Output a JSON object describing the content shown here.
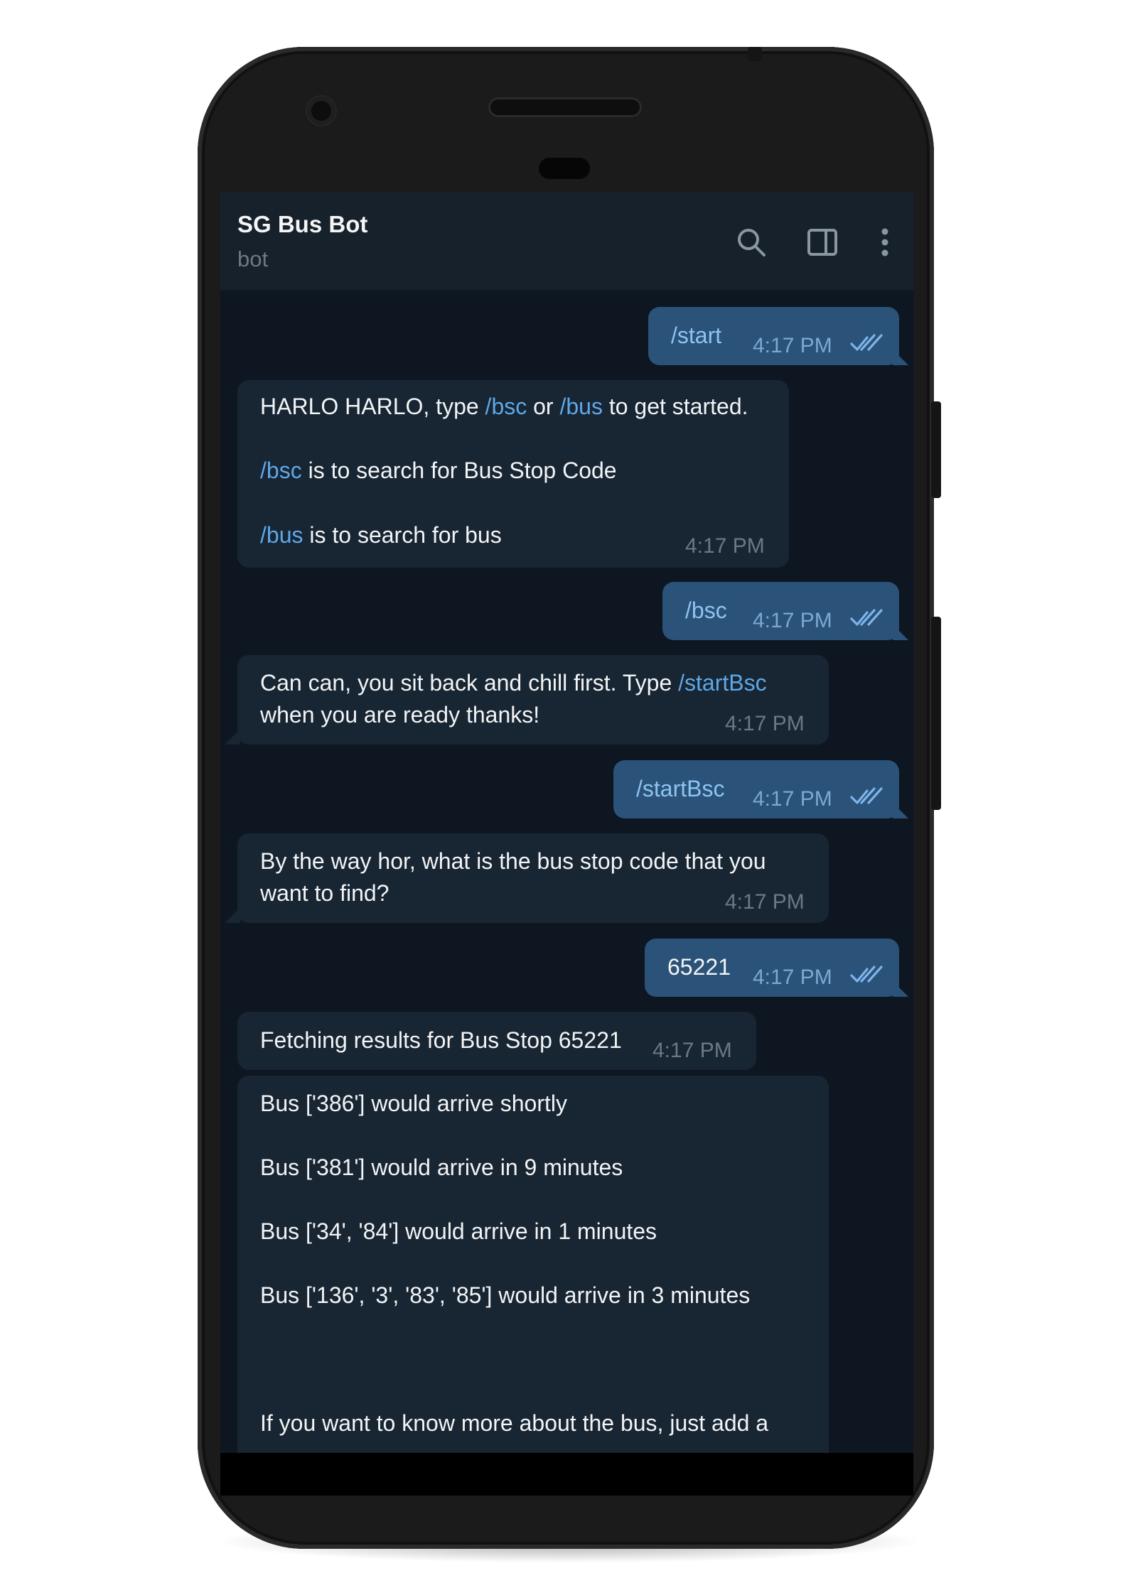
{
  "header": {
    "title": "SG Bus Bot",
    "status": "bot"
  },
  "icons": {
    "search": "search-icon",
    "side_panel": "side-panel-icon",
    "more": "more-vertical-icon",
    "read": "double-check-icon"
  },
  "colors": {
    "chat_bg": "#0e1621",
    "header_bg": "#17212b",
    "incoming_bubble": "#182533",
    "outgoing_bubble": "#2b5278",
    "command_link": "#5ea8e8",
    "timestamp": "#6d7883"
  },
  "messages": {
    "m1": {
      "text": "/start",
      "time": "4:17 PM"
    },
    "m2": {
      "l1a": "HARLO HARLO, type ",
      "l1b": "/bsc",
      "l1c": " or ",
      "l1d": "/bus",
      "l1e": " to get started.",
      "l2a": "/bsc",
      "l2b": " is to search for Bus Stop Code",
      "l3a": "/bus",
      "l3b": " is to search for bus",
      "time": "4:17 PM"
    },
    "m3": {
      "text": "/bsc",
      "time": "4:17 PM"
    },
    "m4": {
      "l1a": "Can can, you sit back and chill first. Type ",
      "l1b": "/startBsc",
      "l2": "when you are ready thanks!",
      "time": "4:17 PM"
    },
    "m5": {
      "text": "/startBsc",
      "time": "4:17 PM"
    },
    "m6": {
      "l1": "By the way hor, what is the bus stop code that you",
      "l2": "want to find?",
      "time": "4:17 PM"
    },
    "m7": {
      "text": "65221",
      "time": "4:17 PM"
    },
    "m8": {
      "text": "Fetching results for Bus Stop 65221",
      "time": "4:17 PM"
    },
    "m9": {
      "l1": "Bus ['386'] would arrive shortly",
      "l2": "Bus ['381'] would arrive in 9 minutes",
      "l3": "Bus ['34', '84'] would arrive in 1 minutes",
      "l4": "Bus ['136', '3', '83', '85'] would arrive in 3 minutes",
      "l5": "If you want to know more about the bus, just add a"
    }
  }
}
